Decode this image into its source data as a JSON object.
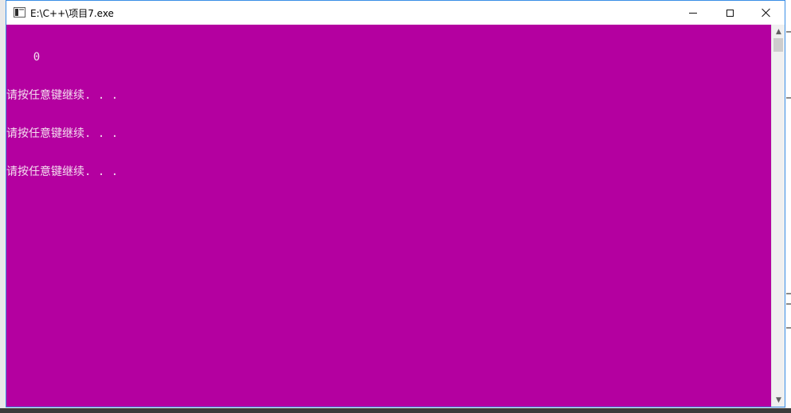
{
  "window": {
    "title": "E:\\C++\\项目7.exe",
    "icon": "console-app-icon",
    "controls": {
      "minimize_icon": "minimize-icon",
      "maximize_icon": "maximize-icon",
      "close_icon": "close-icon"
    }
  },
  "console": {
    "background_color": "#b400a0",
    "text_color": "#f4dff0",
    "lines": [
      "    0",
      "请按任意键继续. . .",
      "请按任意键继续. . .",
      "请按任意键继续. . ."
    ]
  },
  "scrollbar": {
    "up_arrow": "▲",
    "down_arrow": "▼"
  }
}
